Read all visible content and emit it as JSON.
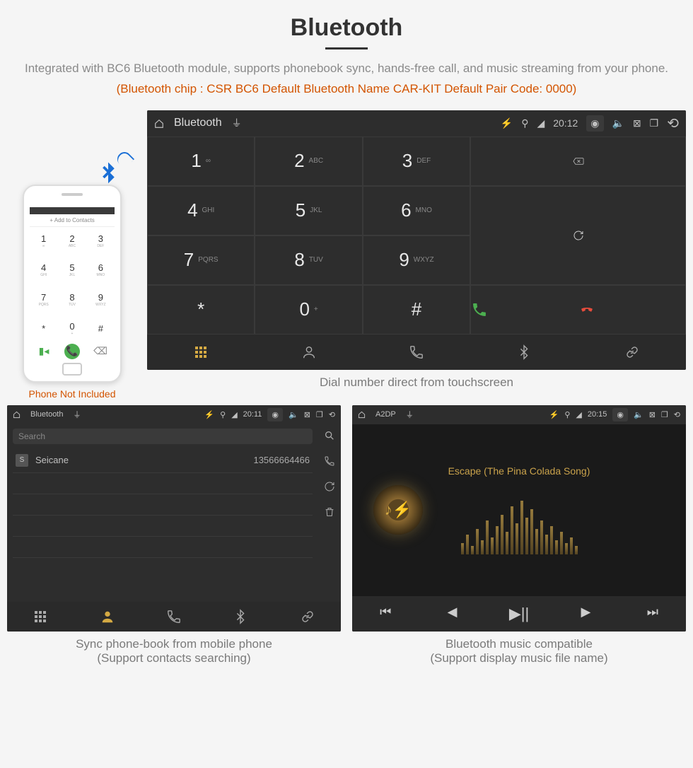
{
  "header": {
    "title": "Bluetooth",
    "desc": "Integrated with BC6 Bluetooth module, supports phonebook sync, hands-free call, and music streaming from your phone.",
    "spec": "(Bluetooth chip : CSR BC6    Default Bluetooth Name CAR-KIT    Default Pair Code: 0000)"
  },
  "phone": {
    "add_label": "+  Add to Contacts",
    "note": "Phone Not Included"
  },
  "dialer": {
    "statusbar": {
      "app": "Bluetooth",
      "time": "20:12"
    },
    "keys": [
      {
        "n": "1",
        "l": "∞"
      },
      {
        "n": "2",
        "l": "ABC"
      },
      {
        "n": "3",
        "l": "DEF"
      },
      {
        "n": "4",
        "l": "GHI"
      },
      {
        "n": "5",
        "l": "JKL"
      },
      {
        "n": "6",
        "l": "MNO"
      },
      {
        "n": "7",
        "l": "PQRS"
      },
      {
        "n": "8",
        "l": "TUV"
      },
      {
        "n": "9",
        "l": "WXYZ"
      },
      {
        "n": "*",
        "l": ""
      },
      {
        "n": "0",
        "l": "+"
      },
      {
        "n": "#",
        "l": ""
      }
    ],
    "caption": "Dial number direct from touchscreen"
  },
  "phonebook": {
    "statusbar": {
      "app": "Bluetooth",
      "time": "20:11"
    },
    "search_placeholder": "Search",
    "contacts": [
      {
        "badge": "S",
        "name": "Seicane",
        "number": "13566664466"
      }
    ],
    "caption": "Sync phone-book from mobile phone",
    "caption2": "(Support contacts searching)"
  },
  "music": {
    "statusbar": {
      "app": "A2DP",
      "time": "20:15"
    },
    "track": "Escape (The Pina Colada Song)",
    "caption": "Bluetooth music compatible",
    "caption2": "(Support display music file name)"
  }
}
